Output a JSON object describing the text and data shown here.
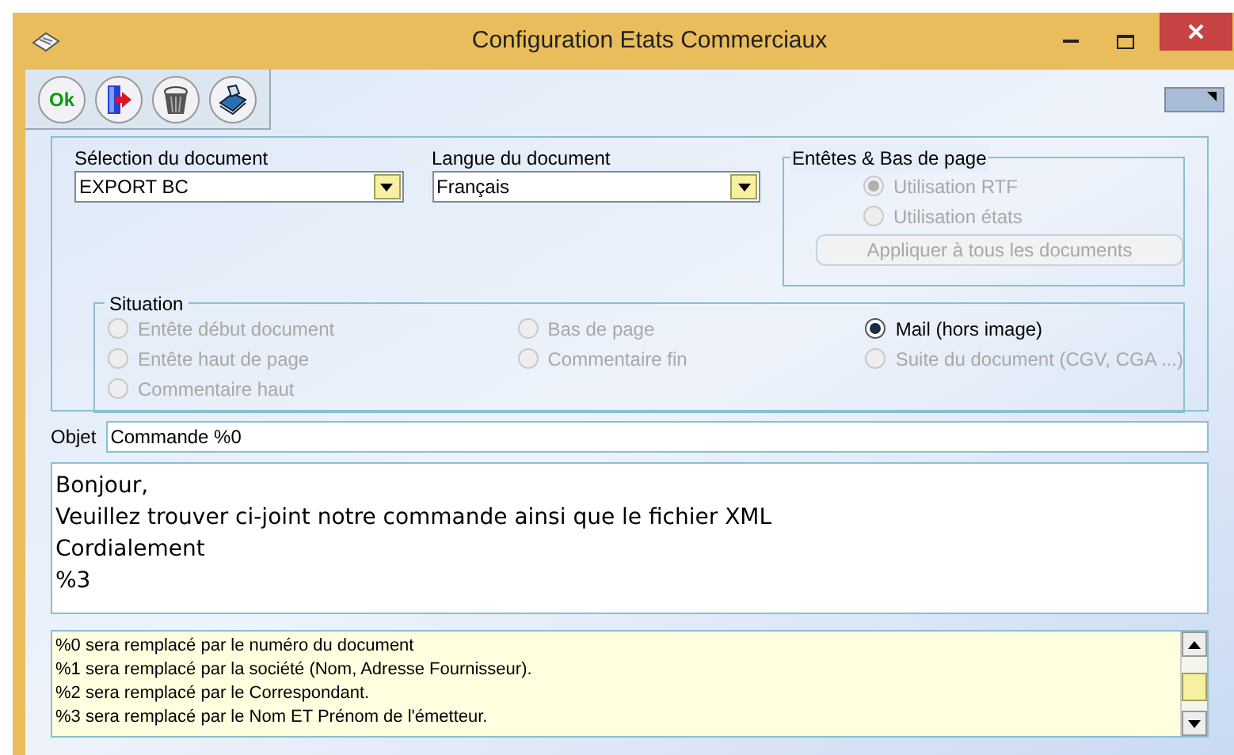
{
  "window": {
    "title": "Configuration Etats Commerciaux"
  },
  "toolbar": [
    {
      "kind": "ok",
      "label": "Ok"
    },
    {
      "kind": "exit"
    },
    {
      "kind": "trash"
    },
    {
      "kind": "print"
    }
  ],
  "document_select": {
    "label": "Sélection du document",
    "value": "EXPORT BC"
  },
  "language_select": {
    "label": "Langue du document",
    "value": "Français"
  },
  "headers_group": {
    "title": "Entêtes & Bas de page",
    "options": [
      {
        "label": "Utilisation RTF",
        "selected": true,
        "disabled": true
      },
      {
        "label": "Utilisation états",
        "selected": false,
        "disabled": true
      }
    ],
    "apply_button": {
      "label": "Appliquer à tous les documents",
      "disabled": true
    }
  },
  "situation": {
    "title": "Situation",
    "columns": [
      [
        {
          "label": "Entête début document",
          "selected": false,
          "disabled": true
        },
        {
          "label": "Entête haut de page",
          "selected": false,
          "disabled": true
        },
        {
          "label": "Commentaire haut",
          "selected": false,
          "disabled": true
        }
      ],
      [
        {
          "label": "Bas de page",
          "selected": false,
          "disabled": true
        },
        {
          "label": "Commentaire fin",
          "selected": false,
          "disabled": true
        }
      ],
      [
        {
          "label": "Mail (hors image)",
          "selected": true,
          "disabled": false
        },
        {
          "label": "Suite du document (CGV, CGA ...)",
          "selected": false,
          "disabled": true
        }
      ]
    ]
  },
  "subject": {
    "label": "Objet",
    "value": "Commande %0"
  },
  "message_lines": [
    "Bonjour,",
    "Veuillez trouver ci-joint notre commande ainsi que le fichier XML",
    "Cordialement",
    "%3"
  ],
  "help_lines": [
    "%0 sera remplacé par le numéro du document",
    "%1 sera remplacé par la société (Nom, Adresse Fournisseur).",
    "%2 sera remplacé par le Correspondant.",
    "%3 sera remplacé par le Nom ET Prénom de l'émetteur."
  ]
}
